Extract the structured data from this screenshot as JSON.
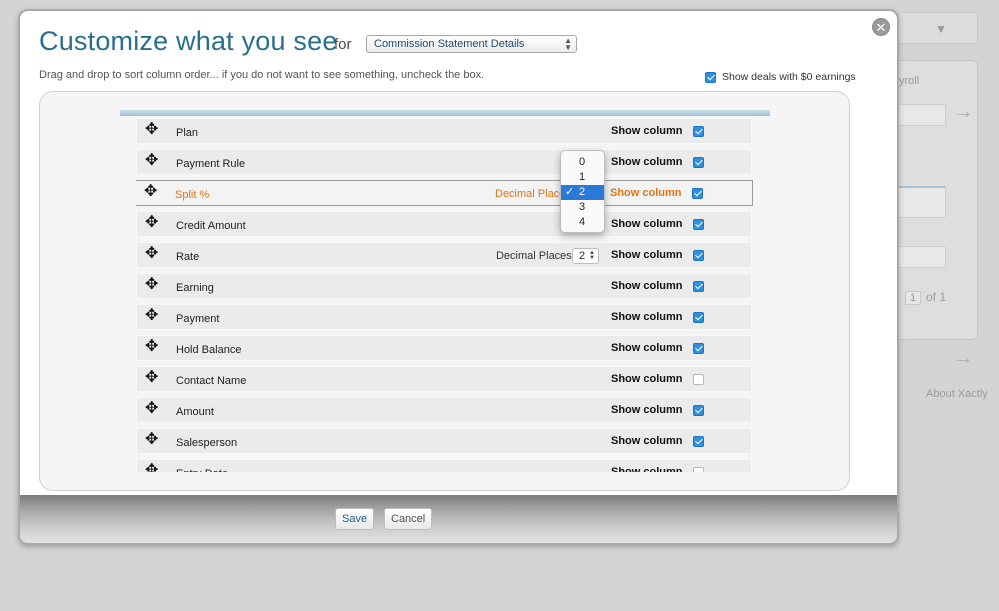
{
  "background": {
    "tab_text": "yroll",
    "pager_page": "1",
    "pager_of": "of 1",
    "about": "About Xactly"
  },
  "modal": {
    "title": "Customize what you see",
    "for_label": "for",
    "statement_select": {
      "value": "Commission Statement Details"
    },
    "instructions": "Drag and drop to sort column order... if you do not want to see something, uncheck the box.",
    "show_zero_label": "Show deals with $0 earnings",
    "show_zero_checked": true,
    "close_icon": "close-icon",
    "save_label": "Save",
    "cancel_label": "Cancel"
  },
  "columns": {
    "show_label": "Show column",
    "decimal_label": "Decimal Places",
    "rows": [
      {
        "label": "Plan",
        "checked": true
      },
      {
        "label": "Payment Rule",
        "checked": true
      },
      {
        "label": "Split %",
        "checked": true,
        "decimal": "2",
        "selected": true
      },
      {
        "label": "Credit Amount",
        "checked": true
      },
      {
        "label": "Rate",
        "checked": true,
        "decimal": "2"
      },
      {
        "label": "Earning",
        "checked": true
      },
      {
        "label": "Payment",
        "checked": true
      },
      {
        "label": "Hold Balance",
        "checked": true
      },
      {
        "label": "Contact Name",
        "checked": false
      },
      {
        "label": "Amount",
        "checked": true
      },
      {
        "label": "Salesperson",
        "checked": true
      },
      {
        "label": "Entry Date",
        "checked": false
      }
    ]
  },
  "decimal_dropdown": {
    "options": [
      "0",
      "1",
      "2",
      "3",
      "4"
    ],
    "selected": "2"
  },
  "colors": {
    "title": "#2a6e8e",
    "selected_row_text": "#e0731a",
    "checkbox": "#2f8fe0",
    "dropdown_highlight": "#2a78d8"
  }
}
